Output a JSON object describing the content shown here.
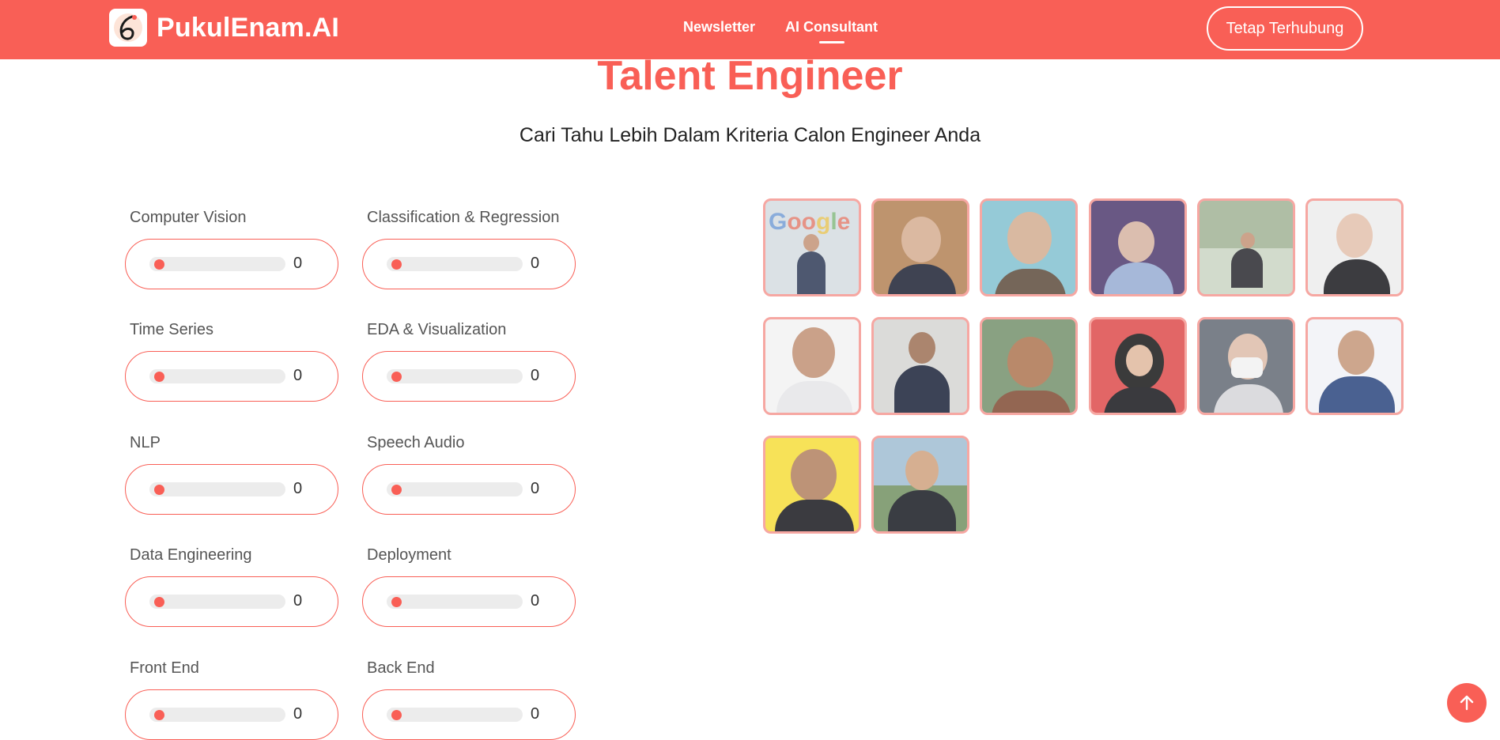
{
  "header": {
    "brand": "PukulEnam.AI",
    "nav": [
      {
        "label": "Newsletter",
        "active": false
      },
      {
        "label": "AI Consultant",
        "active": true
      }
    ],
    "cta_label": "Tetap Terhubung"
  },
  "page": {
    "title": "Talent Engineer",
    "subtitle": "Cari Tahu Lebih Dalam Kriteria Calon Engineer Anda"
  },
  "skills": [
    {
      "label": "Computer Vision",
      "value": "0"
    },
    {
      "label": "Classification & Regression",
      "value": "0"
    },
    {
      "label": "Time Series",
      "value": "0"
    },
    {
      "label": "EDA & Visualization",
      "value": "0"
    },
    {
      "label": "NLP",
      "value": "0"
    },
    {
      "label": "Speech Audio",
      "value": "0"
    },
    {
      "label": "Data Engineering",
      "value": "0"
    },
    {
      "label": "Deployment",
      "value": "0"
    },
    {
      "label": "Front End",
      "value": "0"
    },
    {
      "label": "Back End",
      "value": "0"
    }
  ],
  "colors": {
    "accent": "#f95f56",
    "photo_border": "#f6a09b",
    "track": "#ececec"
  },
  "talents_count_visible": 14
}
